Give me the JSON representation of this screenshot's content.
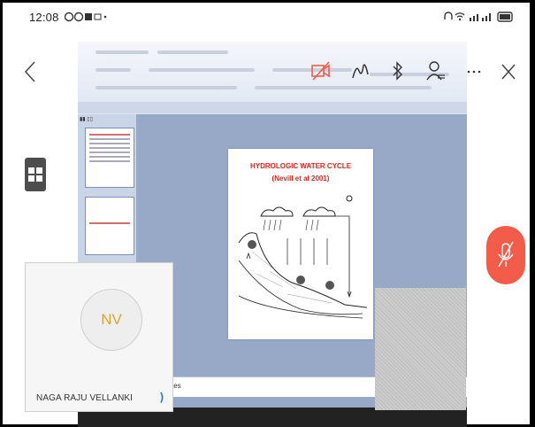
{
  "status_bar": {
    "time": "12:08",
    "left_icons": [
      "whatsapp-icon",
      "notification-icon",
      "gallery-icon",
      "dot-icon"
    ],
    "right_icons": [
      "headphones-icon",
      "wifi-icon",
      "signal-icon",
      "battery-icon"
    ]
  },
  "toolbar": {
    "items": [
      "video-off-icon",
      "annotate-pen-icon",
      "bluetooth-icon",
      "participants-icon",
      "more-icon"
    ]
  },
  "shared_screen": {
    "slide_title_line1": "HYDROLOGIC WATER CYCLE",
    "slide_title_line2": "(Nevill et al 2001)",
    "notes_label": "tes"
  },
  "participant": {
    "initials": "NV",
    "name": "NAGA RAJU VELLANKI"
  },
  "colors": {
    "accent_red": "#f25c48",
    "avatar_initials": "#d9a336",
    "slide_title": "#e0231b"
  }
}
